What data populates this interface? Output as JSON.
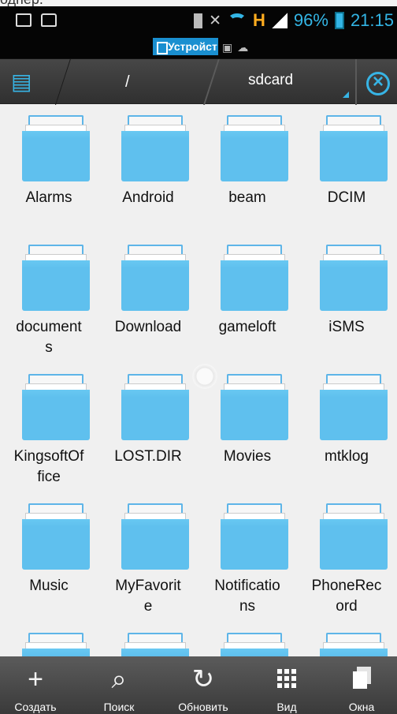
{
  "crop_text": "одпер.",
  "status": {
    "network_type": "H",
    "battery_percent": "96%",
    "time": "21:15"
  },
  "tabs": {
    "active_label": "Устройст"
  },
  "path": {
    "root": "/",
    "current": "sdcard"
  },
  "folders": [
    "Alarms",
    "Android",
    "beam",
    "DCIM",
    "document\ns",
    "Download",
    "gameloft",
    "iSMS",
    "KingsoftOf\nfice",
    "LOST.DIR",
    "Movies",
    "mtklog",
    "Music",
    "MyFavorit\ne",
    "Notificatio\nns",
    "PhoneRec\nord"
  ],
  "bottom": {
    "create": "Создать",
    "search": "Поиск",
    "refresh": "Обновить",
    "view": "Вид",
    "windows": "Окна"
  },
  "colors": {
    "accent": "#37b4e5",
    "folder": "#5fc0ee",
    "status_bar": "#050505",
    "toolbar": "#3f3f3f"
  },
  "icons": {
    "device": "device-icon",
    "close": "close-circle-icon",
    "create": "plus-icon",
    "search": "search-icon",
    "refresh": "refresh-icon",
    "view": "grid-icon",
    "windows": "windows-icon"
  }
}
